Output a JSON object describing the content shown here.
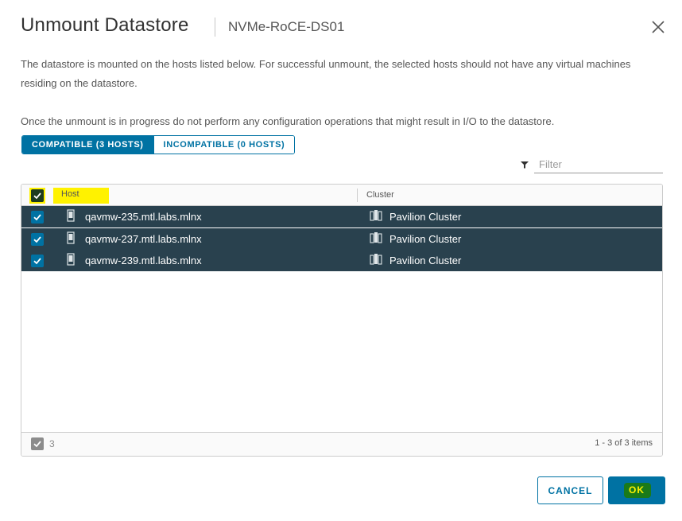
{
  "dialog": {
    "title": "Unmount Datastore",
    "subtitle": "NVMe-RoCE-DS01",
    "close_icon": "close-icon"
  },
  "description": {
    "paragraph1": "The datastore is mounted on the hosts listed below. For successful unmount, the selected hosts should not have any virtual machines residing on the datastore.",
    "paragraph2": "Once the unmount is in progress do not perform any configuration operations that might result in I/O to the datastore."
  },
  "tabs": [
    {
      "label": "COMPATIBLE (3 HOSTS)",
      "active": true
    },
    {
      "label": "INCOMPATIBLE (0 HOSTS)",
      "active": false
    }
  ],
  "filter": {
    "placeholder": "Filter",
    "icon": "filter-icon"
  },
  "grid": {
    "columns": {
      "host": "Host",
      "cluster": "Cluster"
    },
    "select_all_checked": true,
    "rows": [
      {
        "host": "qavmw-235.mtl.labs.mlnx",
        "cluster": "Pavilion Cluster",
        "checked": true
      },
      {
        "host": "qavmw-237.mtl.labs.mlnx",
        "cluster": "Pavilion Cluster",
        "checked": true
      },
      {
        "host": "qavmw-239.mtl.labs.mlnx",
        "cluster": "Pavilion Cluster",
        "checked": true
      }
    ],
    "footer": {
      "selected_count": "3",
      "range": "1 - 3 of 3 items"
    }
  },
  "buttons": {
    "cancel": "CANCEL",
    "ok": "OK"
  },
  "colors": {
    "accent": "#0072a3",
    "selected_row": "#29414e",
    "highlight": "#fff200"
  }
}
